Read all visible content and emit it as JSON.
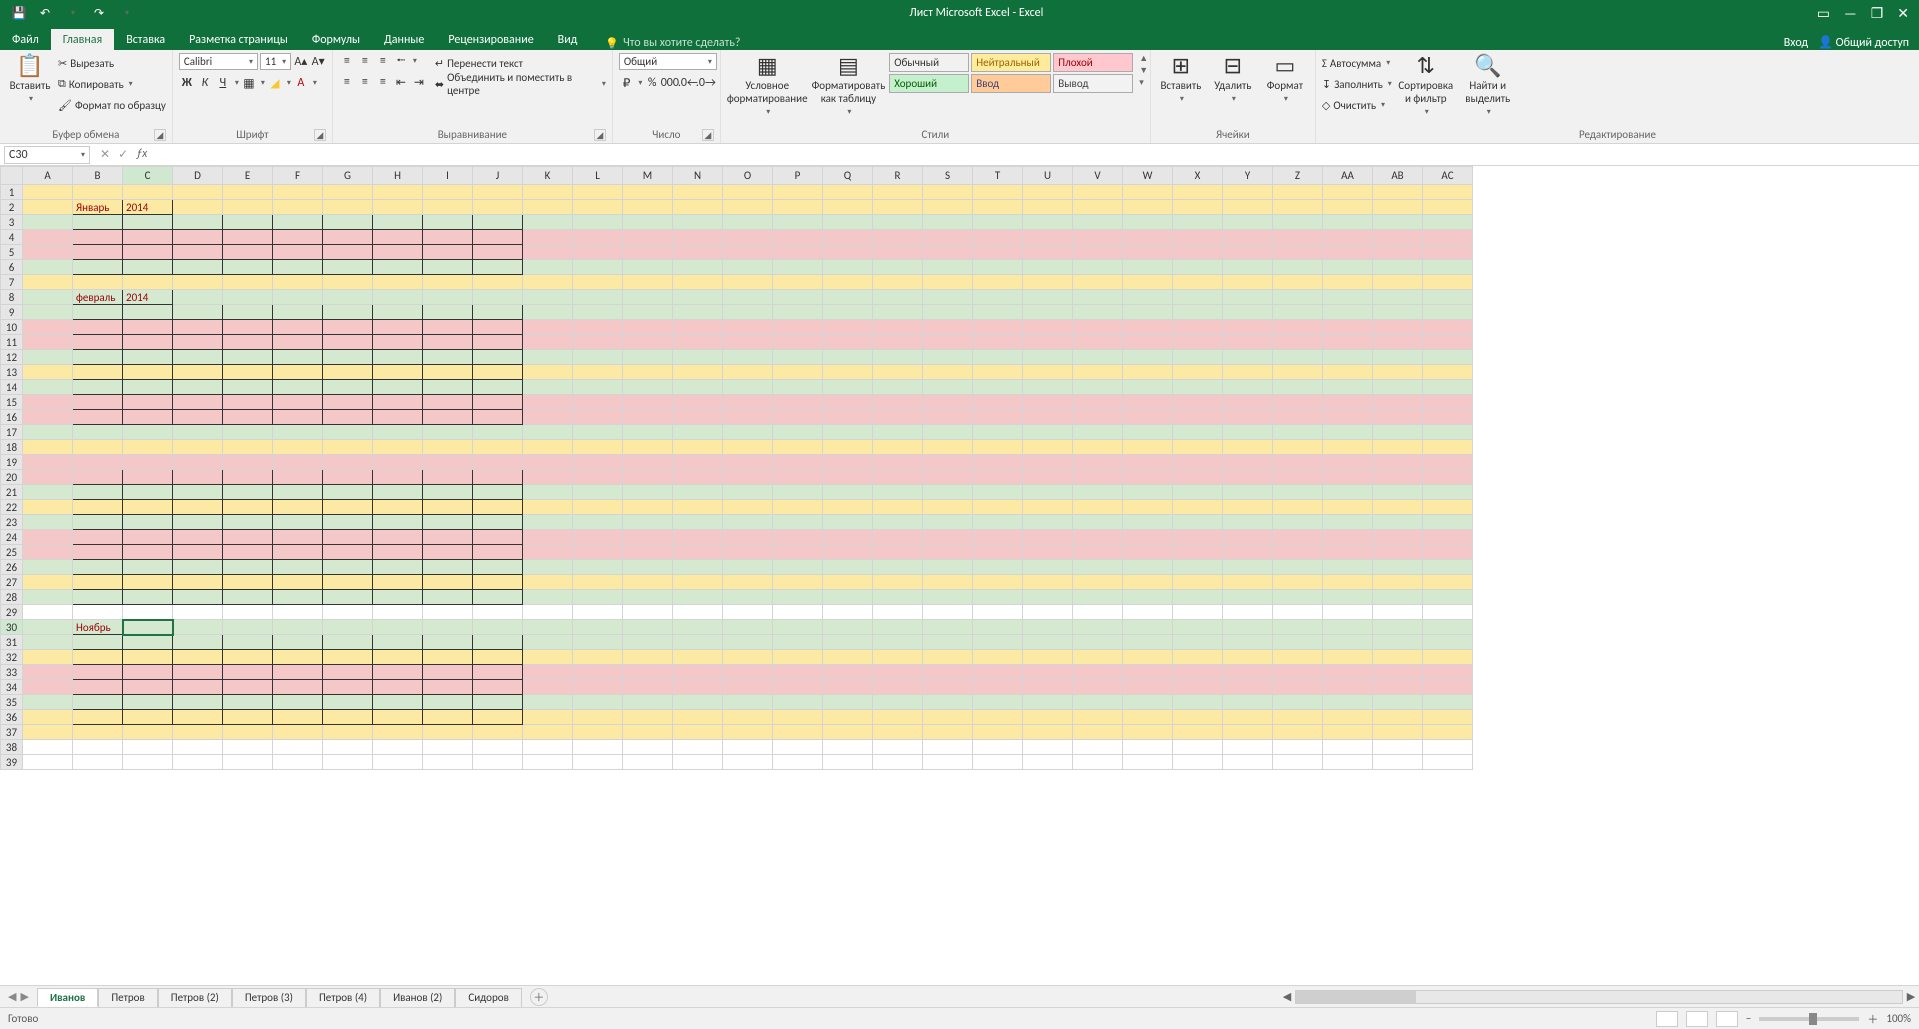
{
  "app": {
    "title": "Лист Microsoft Excel - Excel"
  },
  "qat": {
    "save": "💾",
    "undo": "↶",
    "redo": "↷"
  },
  "wincontrols": {
    "ribbonopts": "▭",
    "min": "—",
    "restore": "❐",
    "close": "✕"
  },
  "tabs": {
    "file": "Файл",
    "home": "Главная",
    "insert": "Вставка",
    "layout": "Разметка страницы",
    "formulas": "Формулы",
    "data": "Данные",
    "review": "Рецензирование",
    "view": "Вид"
  },
  "search_placeholder": "Что вы хотите сделать?",
  "account": {
    "signin": "Вход",
    "share": "Общий доступ"
  },
  "ribbon": {
    "clipboard": {
      "label": "Буфер обмена",
      "paste": "Вставить",
      "cut": "Вырезать",
      "copy": "Копировать",
      "format_painter": "Формат по образцу"
    },
    "font": {
      "label": "Шрифт",
      "name": "Calibri",
      "size": "11"
    },
    "alignment": {
      "label": "Выравнивание",
      "wrap": "Перенести текст",
      "merge": "Объединить и поместить в центре"
    },
    "number": {
      "label": "Число",
      "format": "Общий"
    },
    "styles": {
      "label": "Стили",
      "conditional": "Условное форматирование",
      "format_table": "Форматировать как таблицу",
      "cells": {
        "normal": "Обычный",
        "neutral": "Нейтральный",
        "bad": "Плохой",
        "good": "Хороший",
        "input": "Ввод",
        "output": "Вывод"
      }
    },
    "cells": {
      "label": "Ячейки",
      "insert": "Вставить",
      "delete": "Удалить",
      "format": "Формат"
    },
    "editing": {
      "label": "Редактирование",
      "autosum": "Автосумма",
      "fill": "Заполнить",
      "clear": "Очистить",
      "sort": "Сортировка и фильтр",
      "find": "Найти и выделить"
    }
  },
  "namebox": "C30",
  "columns": [
    "A",
    "B",
    "C",
    "D",
    "E",
    "F",
    "G",
    "H",
    "I",
    "J",
    "K",
    "L",
    "M",
    "N",
    "O",
    "P",
    "Q",
    "R",
    "S",
    "T",
    "U",
    "V",
    "W",
    "X",
    "Y",
    "Z",
    "AA",
    "AB",
    "AC"
  ],
  "active_col": "C",
  "active_row": 30,
  "first_row": 1,
  "last_row": 39,
  "row_fill": {
    "1": "yellow",
    "2": "yellow",
    "3": "green",
    "4": "pink",
    "5": "pink",
    "6": "green",
    "7": "yellow",
    "8": "green",
    "9": "green",
    "10": "pink",
    "11": "pink",
    "12": "green",
    "13": "yellow",
    "14": "green",
    "15": "pink",
    "16": "pink",
    "17": "green",
    "18": "yellow",
    "19": "pink",
    "20": "pink",
    "21": "green",
    "22": "yellow",
    "23": "green",
    "24": "pink",
    "25": "pink",
    "26": "green",
    "27": "yellow",
    "28": "green",
    "29": "",
    "30": "green",
    "31": "green",
    "32": "yellow",
    "33": "pink",
    "34": "pink",
    "35": "green",
    "36": "yellow",
    "37": "yellow",
    "38": "",
    "39": ""
  },
  "tables": [
    {
      "header_row": 2,
      "label": "Январь",
      "year": "2014",
      "body_rows": [
        3,
        4,
        5,
        6
      ]
    },
    {
      "header_row": 8,
      "label": "февраль",
      "year": "2014",
      "body_rows": [
        9,
        10,
        11,
        12,
        13,
        14,
        15,
        16
      ]
    },
    {
      "header_row": null,
      "label": "",
      "year": "",
      "body_rows": [
        20,
        21,
        22,
        23,
        24,
        25,
        26,
        27,
        28
      ]
    },
    {
      "header_row": 30,
      "label": "Ноябрь",
      "year": "",
      "body_rows": [
        31,
        32,
        33,
        34,
        35,
        36
      ]
    }
  ],
  "sheet_tabs": [
    "Иванов",
    "Петров",
    "Петров  (2)",
    "Петров  (3)",
    "Петров  (4)",
    "Иванов  (2)",
    "Сидоров"
  ],
  "active_sheet_tab": 0,
  "status": {
    "ready": "Готово",
    "zoom": "100%"
  }
}
